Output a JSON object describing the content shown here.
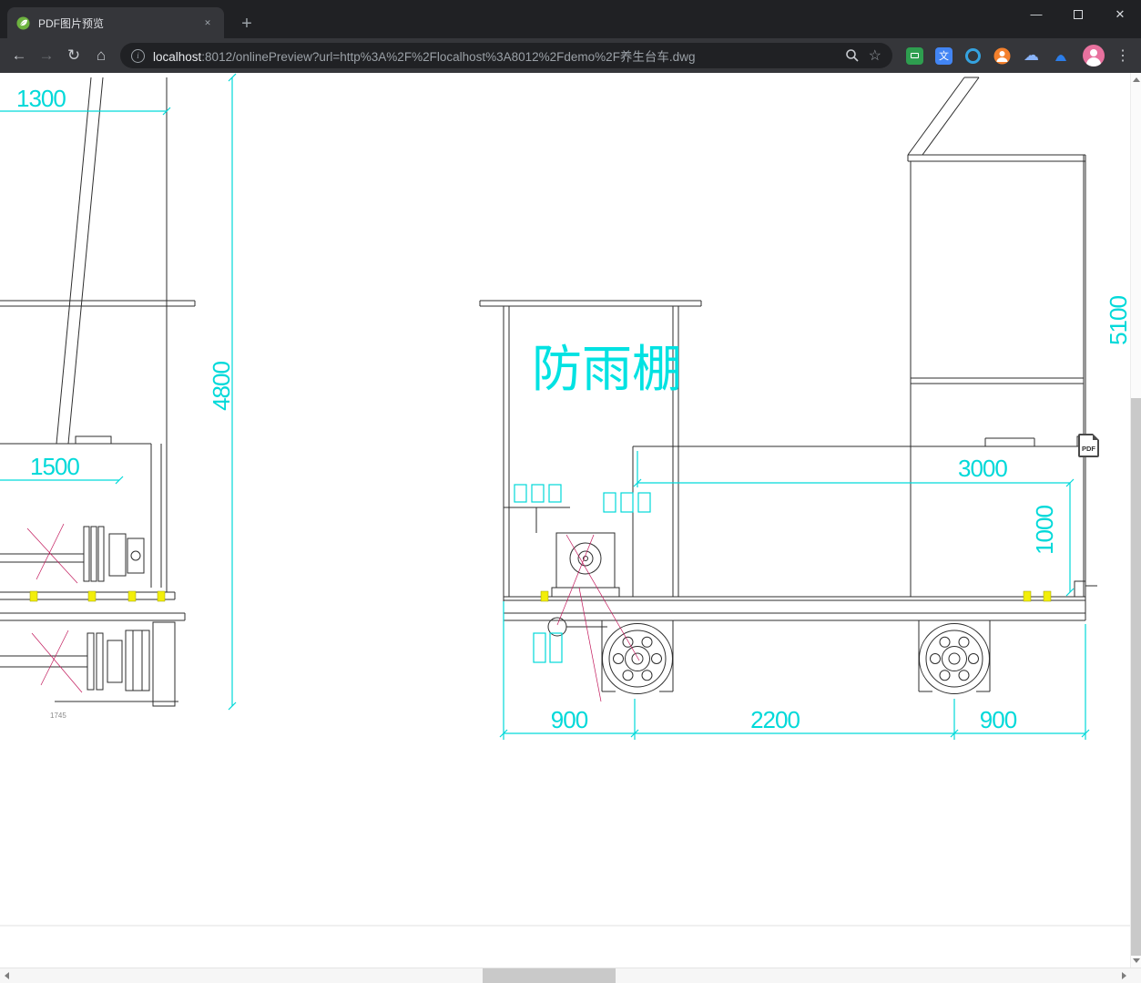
{
  "browser": {
    "tab": {
      "title": "PDF图片预览",
      "close_glyph": "✕"
    },
    "new_tab_glyph": "+",
    "window_controls": {
      "minimize_glyph": "—",
      "close_glyph": "✕"
    },
    "nav": {
      "back_glyph": "←",
      "forward_glyph": "→",
      "reload_glyph": "↻",
      "home_glyph": "⌂"
    },
    "omnibox": {
      "info_glyph": "i",
      "url_host": "localhost",
      "url_rest": ":8012/onlinePreview?url=http%3A%2F%2Flocalhost%3A8012%2Fdemo%2F养生台车.dwg",
      "star_glyph": "☆"
    },
    "extensions": {
      "translate_glyph": "文",
      "cloud_glyph": "☁"
    },
    "menu_glyph": "⋮"
  },
  "viewer": {
    "pdf_badge": "PDF",
    "drawing": {
      "shelter_label": "防雨棚",
      "dim_1300": "1300",
      "dim_1500": "1500",
      "dim_4800": "4800",
      "dim_5100": "5100",
      "dim_3000": "3000",
      "dim_1000": "1000",
      "dim_900_left": "900",
      "dim_2200": "2200",
      "dim_900_right": "900",
      "note_small": "1745"
    },
    "colors": {
      "dimension_cyan": "#00d9d9",
      "cad_line": "#2e2e2e",
      "highlight_yellow": "#f2ee0a",
      "accent_magenta": "#c2185b",
      "page_background": "#ffffff"
    }
  }
}
